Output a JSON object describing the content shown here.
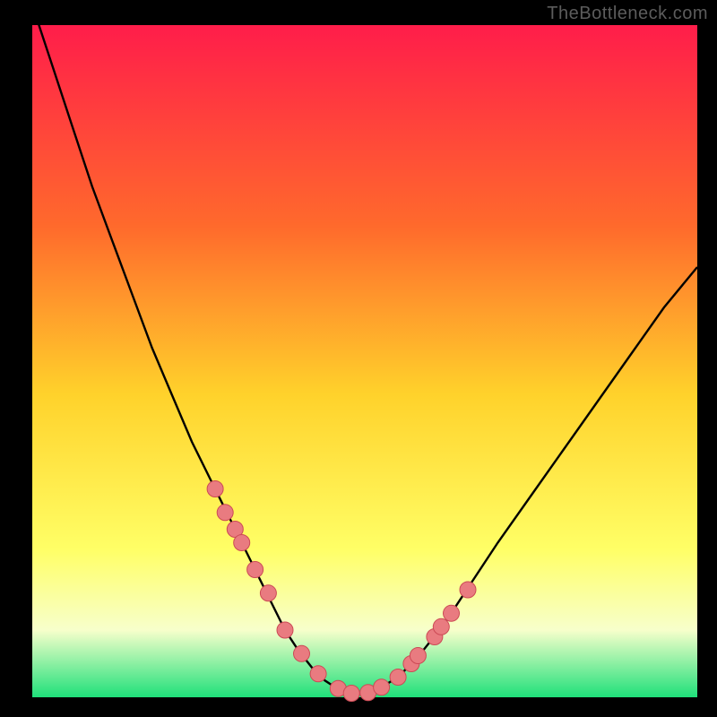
{
  "watermark": "TheBottleneck.com",
  "colors": {
    "frame": "#000000",
    "gradient_top": "#ff1d4a",
    "gradient_upper_mid": "#ff6a2c",
    "gradient_mid": "#ffd22b",
    "gradient_lower_mid": "#ffff66",
    "gradient_pale": "#f7ffcb",
    "gradient_bottom": "#1fe07a",
    "curve": "#000000",
    "marker_fill": "#e97b80",
    "marker_stroke": "#cc4a55"
  },
  "chart_data": {
    "type": "line",
    "title": "",
    "xlabel": "",
    "ylabel": "",
    "xlim": [
      0,
      100
    ],
    "ylim": [
      0,
      100
    ],
    "series": [
      {
        "name": "bottleneck-curve",
        "x": [
          0,
          3,
          6,
          9,
          12,
          15,
          18,
          21,
          24,
          27,
          30,
          33,
          36,
          38,
          40,
          42,
          44,
          46,
          48,
          50,
          52,
          55,
          58,
          62,
          66,
          70,
          75,
          80,
          85,
          90,
          95,
          100
        ],
        "y": [
          103,
          94,
          85,
          76,
          68,
          60,
          52,
          45,
          38,
          32,
          26,
          20,
          14,
          10,
          7,
          4.5,
          2.5,
          1.2,
          0.5,
          0.5,
          1.2,
          3,
          6,
          11,
          17,
          23,
          30,
          37,
          44,
          51,
          58,
          64
        ]
      }
    ],
    "markers": {
      "name": "highlighted-points",
      "x": [
        27.5,
        29,
        30.5,
        31.5,
        33.5,
        35.5,
        38,
        40.5,
        43,
        46,
        48,
        50.5,
        52.5,
        55,
        57,
        58,
        60.5,
        61.5,
        63,
        65.5
      ],
      "y": [
        31,
        27.5,
        25,
        23,
        19,
        15.5,
        10,
        6.5,
        3.5,
        1.3,
        0.6,
        0.7,
        1.5,
        3,
        5,
        6.2,
        9,
        10.5,
        12.5,
        16
      ]
    }
  }
}
